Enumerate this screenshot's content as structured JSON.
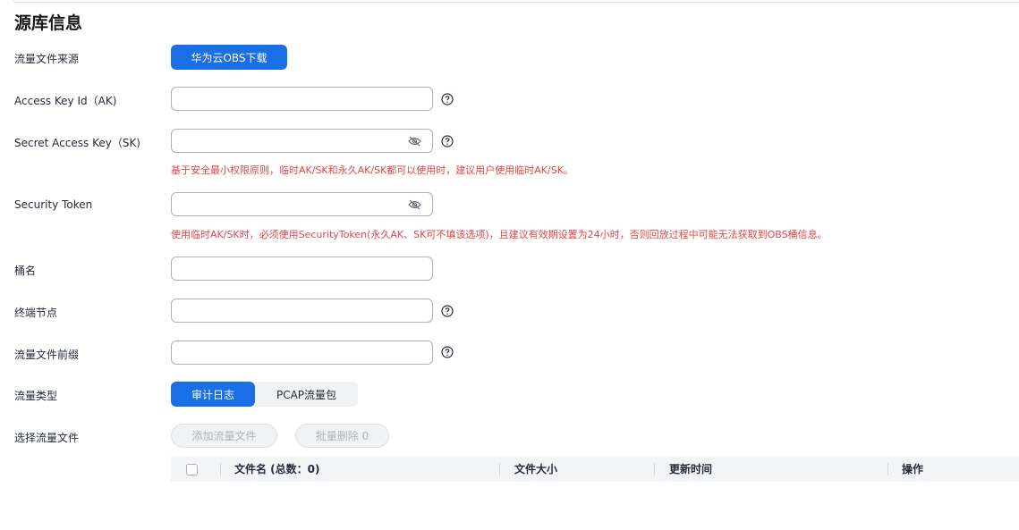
{
  "section": {
    "title": "源库信息"
  },
  "fields": {
    "source": {
      "label": "流量文件来源",
      "button_label": "华为云OBS下载"
    },
    "ak": {
      "label": "Access Key Id（AK)",
      "value": ""
    },
    "sk": {
      "label": "Secret Access Key（SK)",
      "value": "",
      "hint": "基于安全最小权限原则，临时AK/SK和永久AK/SK都可以使用时，建议用户使用临时AK/SK。"
    },
    "token": {
      "label": "Security Token",
      "value": "",
      "hint": "使用临时AK/SK时，必须使用SecurityToken(永久AK、SK可不填该选项)，且建议有效期设置为24小时，否则回放过程中可能无法获取到OBS桶信息。"
    },
    "bucket": {
      "label": "桶名",
      "value": ""
    },
    "endpoint": {
      "label": "终端节点",
      "value": ""
    },
    "prefix": {
      "label": "流量文件前缀",
      "value": ""
    },
    "traffic_type": {
      "label": "流量类型",
      "options": [
        "审计日志",
        "PCAP流量包"
      ],
      "selected": "审计日志"
    },
    "select_files": {
      "label": "选择流量文件",
      "add_label": "添加流量文件",
      "batch_delete_label": "批量删除 0"
    }
  },
  "table": {
    "columns": [
      "文件名 (总数：0)",
      "文件大小",
      "更新时间",
      "操作"
    ]
  },
  "colors": {
    "primary": "#1a6ee6",
    "hint": "#e54545"
  },
  "icons": {
    "help": "help-icon",
    "password_toggle": "eye-hidden-icon"
  }
}
